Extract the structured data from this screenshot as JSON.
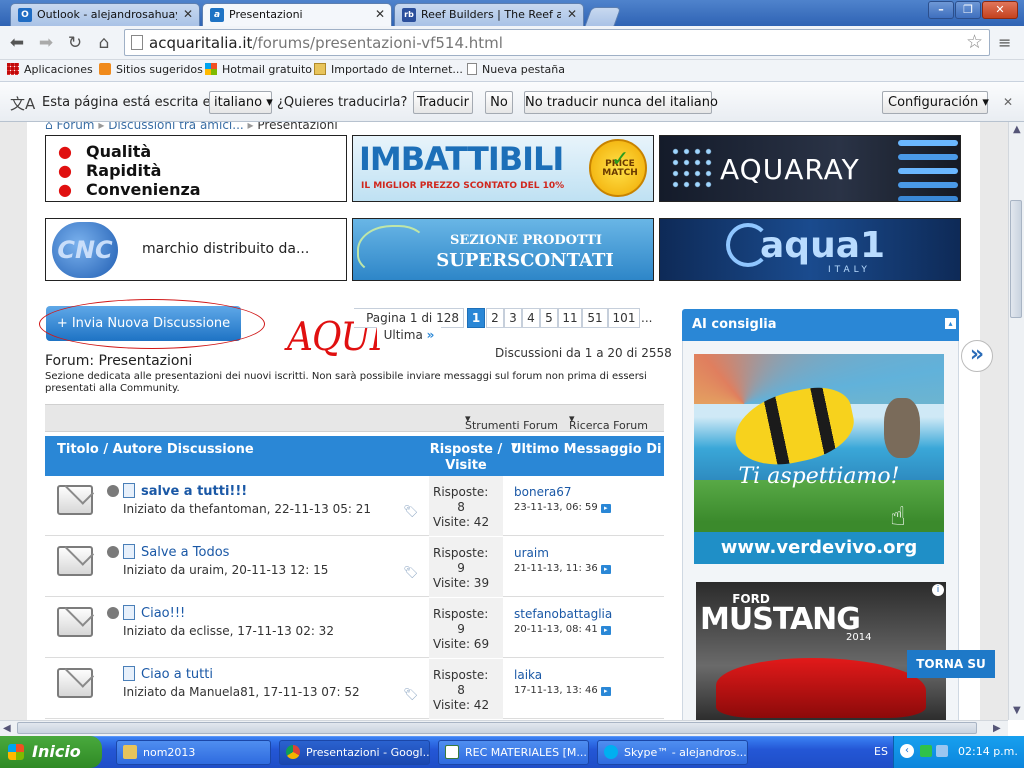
{
  "browser": {
    "tabs": [
      {
        "label": "Outlook - alejandrosahuaya@",
        "icon": "O"
      },
      {
        "label": "Presentazioni",
        "icon": "a"
      },
      {
        "label": "Reef Builders | The Reef and",
        "icon": "rb"
      }
    ],
    "url_host": "acquaritalia.it",
    "url_path": "/forums/presentazioni-vf514.html",
    "bookmarks": [
      "Aplicaciones",
      "Sitios sugeridos",
      "Hotmail gratuito",
      "Importado de Internet...",
      "Nueva pestaña"
    ],
    "translate": {
      "msg": "Esta página está escrita en",
      "language": "italiano",
      "question": "¿Quieres traducirla?",
      "translate_btn": "Traducir",
      "no_btn": "No",
      "never_btn": "No traducir nunca del italiano",
      "config_btn": "Configuración"
    }
  },
  "page": {
    "breadcrumb": [
      "Forum",
      "Discussioni tra amici...",
      "Presentazioni"
    ],
    "banners": {
      "qualita": [
        "Qualità",
        "Rapidità",
        "Convenienza"
      ],
      "imbattibili_title": "IMBATTIBILI",
      "imbattibili_sub": "IL MIGLIOR PREZZO SCONTATO DEL 10%",
      "price_match": "PRICE MATCH",
      "aquaray": "AQUARAY",
      "cnc_logo": "CNC",
      "cnc_text": "marchio distribuito da...",
      "superscontati_1": "SEZIONE PRODOTTI",
      "superscontati_2": "SUPERSCONTATI",
      "aqua1": "aqua1",
      "aqua1_sub": "ITALY"
    },
    "new_thread_btn": "+ Invia Nuova Discussione",
    "annotation": "AQUI",
    "pagination": {
      "label": "Pagina 1 di 128",
      "pages": [
        "1",
        "2",
        "3",
        "4",
        "5",
        "11",
        "51",
        "101"
      ],
      "more": "...",
      "last": "Ultima"
    },
    "count_info": "Discussioni da 1 a 20 di 2558",
    "forum_title": "Forum: Presentazioni",
    "forum_desc": "Sezione dedicata alle presentazioni dei nuovi iscritti. Non sarà possibile inviare messaggi sul forum non prima di essersi presentati alla Community.",
    "tools": {
      "strumenti": "Strumenti Forum",
      "ricerca": "Ricerca Forum"
    },
    "thead": {
      "title": "Titolo / Autore Discussione",
      "replies1": "Risposte /",
      "replies2": "Visite",
      "last": "Ultimo Messaggio Di"
    },
    "threads": [
      {
        "title": "salve a tutti!!!",
        "starter": "Iniziato da thefantoman, 22-11-13 05: 21",
        "replies": "Risposte:",
        "replies_n": "8",
        "views": "Visite: 42",
        "last_user": "bonera67",
        "last_date": "23-11-13, 06: 59",
        "bold": true
      },
      {
        "title": "Salve a Todos",
        "starter": "Iniziato da uraim, 20-11-13 12: 15",
        "replies": "Risposte:",
        "replies_n": "9",
        "views": "Visite: 39",
        "last_user": "uraim",
        "last_date": "21-11-13, 11: 36",
        "bold": false
      },
      {
        "title": "Ciao!!!",
        "starter": "Iniziato da eclisse, 17-11-13 02: 32",
        "replies": "Risposte:",
        "replies_n": "9",
        "views": "Visite: 69",
        "last_user": "stefanobattaglia",
        "last_date": "20-11-13, 08: 41",
        "bold": false
      },
      {
        "title": "Ciao a tutti",
        "starter": "Iniziato da Manuela81, 17-11-13 07: 52",
        "replies": "Risposte:",
        "replies_n": "8",
        "views": "Visite: 42",
        "last_user": "laika",
        "last_date": "17-11-13, 13: 46",
        "bold": false
      }
    ],
    "sidebar": {
      "title": "AI consiglia",
      "ad1_slogan": "Ti aspettiamo!",
      "ad1_url": "www.verdevivo.org",
      "ad2_brand": "FORD",
      "ad2_model": "MUSTANG",
      "ad2_year": "2014"
    },
    "torna_su": "TORNA SU"
  },
  "taskbar": {
    "start": "Inicio",
    "tasks": [
      "nom2013",
      "Presentazioni - Googl...",
      "REC MATERIALES [M...",
      "Skype™ - alejandros..."
    ],
    "lang": "ES",
    "clock": "02:14 p.m."
  }
}
